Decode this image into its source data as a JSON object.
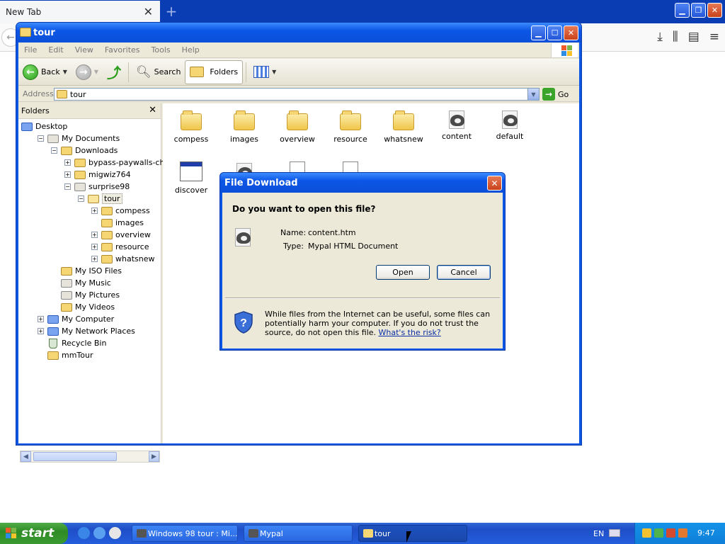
{
  "browser": {
    "tab_title": "New Tab",
    "tab_close": "✕",
    "new_tab": "+",
    "toolbar_icons": [
      "download-icon",
      "library-icon",
      "sidebar-icon",
      "menu-icon"
    ]
  },
  "explorer": {
    "title": "tour",
    "title_buttons": {
      "minimize": "▁",
      "maximize": "☐",
      "close": "✕"
    },
    "menu": [
      "File",
      "Edit",
      "View",
      "Favorites",
      "Tools",
      "Help"
    ],
    "toolbar": {
      "back": "Back",
      "search": "Search",
      "folders": "Folders"
    },
    "address": {
      "label": "Address",
      "value": "tour",
      "go": "Go"
    },
    "folders_pane": {
      "title": "Folders",
      "tree": [
        {
          "label": "Desktop",
          "depth": 0,
          "expander": "",
          "icon": "desktop-icon"
        },
        {
          "label": "My Documents",
          "depth": 1,
          "expander": "−",
          "icon": "my-documents-icon"
        },
        {
          "label": "Downloads",
          "depth": 2,
          "expander": "−",
          "icon": "folder-icon"
        },
        {
          "label": "bypass-paywalls-chrome-",
          "depth": 3,
          "expander": "+",
          "icon": "folder-icon"
        },
        {
          "label": "migwiz764",
          "depth": 3,
          "expander": "+",
          "icon": "folder-icon"
        },
        {
          "label": "surprise98",
          "depth": 3,
          "expander": "−",
          "icon": "zip-folder-icon"
        },
        {
          "label": "tour",
          "depth": 4,
          "expander": "−",
          "icon": "open-folder-icon",
          "selected": true
        },
        {
          "label": "compess",
          "depth": 5,
          "expander": "+",
          "icon": "folder-icon"
        },
        {
          "label": "images",
          "depth": 5,
          "expander": "",
          "icon": "folder-icon"
        },
        {
          "label": "overview",
          "depth": 5,
          "expander": "+",
          "icon": "folder-icon"
        },
        {
          "label": "resource",
          "depth": 5,
          "expander": "+",
          "icon": "folder-icon"
        },
        {
          "label": "whatsnew",
          "depth": 5,
          "expander": "+",
          "icon": "folder-icon"
        },
        {
          "label": "My ISO Files",
          "depth": 2,
          "expander": "",
          "icon": "folder-icon"
        },
        {
          "label": "My Music",
          "depth": 2,
          "expander": "",
          "icon": "music-folder-icon"
        },
        {
          "label": "My Pictures",
          "depth": 2,
          "expander": "",
          "icon": "pictures-folder-icon"
        },
        {
          "label": "My Videos",
          "depth": 2,
          "expander": "",
          "icon": "folder-icon"
        },
        {
          "label": "My Computer",
          "depth": 1,
          "expander": "+",
          "icon": "computer-icon"
        },
        {
          "label": "My Network Places",
          "depth": 1,
          "expander": "+",
          "icon": "network-icon"
        },
        {
          "label": "Recycle Bin",
          "depth": 1,
          "expander": "",
          "icon": "recycle-bin-icon"
        },
        {
          "label": "mmTour",
          "depth": 1,
          "expander": "",
          "icon": "folder-icon"
        }
      ]
    },
    "files": [
      {
        "label": "compess",
        "type": "folder"
      },
      {
        "label": "images",
        "type": "folder"
      },
      {
        "label": "overview",
        "type": "folder"
      },
      {
        "label": "resource",
        "type": "folder"
      },
      {
        "label": "whatsnew",
        "type": "folder"
      },
      {
        "label": "content",
        "type": "mypal-html"
      },
      {
        "label": "default",
        "type": "mypal-html"
      },
      {
        "label": "discover",
        "type": "application"
      },
      {
        "label": "",
        "type": "mypal-html"
      },
      {
        "label": "",
        "type": "document"
      },
      {
        "label": "",
        "type": "document"
      }
    ]
  },
  "dialog": {
    "title": "File Download",
    "close": "✕",
    "question": "Do you want to open this file?",
    "name_label": "Name:",
    "name_value": "content.htm",
    "type_label": "Type:",
    "type_value": "Mypal HTML Document",
    "open_button": "Open",
    "cancel_button": "Cancel",
    "warning": "While files from the Internet can be useful, some files can potentially harm your computer. If you do not trust the source, do not open this file.",
    "risk_link": "What's the risk?"
  },
  "taskbar": {
    "start": "start",
    "items": [
      {
        "label": "Windows 98 tour : Mi...",
        "active": false
      },
      {
        "label": "Mypal",
        "active": false
      },
      {
        "label": "tour",
        "active": true
      }
    ],
    "language": "EN",
    "clock": "9:47"
  },
  "colors": {
    "xp_blue": "#0c56e6",
    "start_green": "#3a9a30",
    "tray_blue": "#0f7fd8",
    "link": "#0a2ea8"
  }
}
